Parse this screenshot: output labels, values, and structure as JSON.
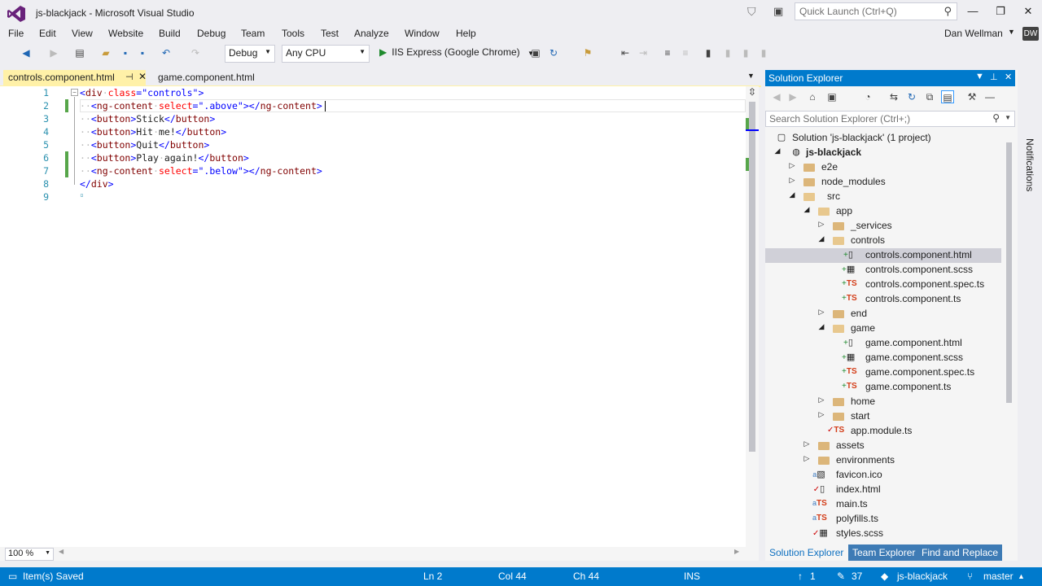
{
  "window": {
    "title": "js-blackjack - Microsoft Visual Studio",
    "quick_launch_placeholder": "Quick Launch (Ctrl+Q)",
    "user_name": "Dan Wellman",
    "user_initials": "DW"
  },
  "menu": [
    "File",
    "Edit",
    "View",
    "Website",
    "Build",
    "Debug",
    "Team",
    "Tools",
    "Test",
    "Analyze",
    "Window",
    "Help"
  ],
  "toolbar": {
    "config": "Debug",
    "platform": "Any CPU",
    "run_label": "IIS Express (Google Chrome)"
  },
  "tabs": {
    "active": "controls.component.html",
    "second": "game.component.html"
  },
  "editor": {
    "line_numbers": [
      "1",
      "2",
      "3",
      "4",
      "5",
      "6",
      "7",
      "8",
      "9"
    ],
    "zoom": "100 %"
  },
  "solution_explorer": {
    "title": "Solution Explorer",
    "search_placeholder": "Search Solution Explorer (Ctrl+;)",
    "nodes": [
      "Solution 'js-blackjack' (1 project)",
      "js-blackjack",
      "e2e",
      "node_modules",
      "src",
      "app",
      "_services",
      "controls",
      "controls.component.html",
      "controls.component.scss",
      "controls.component.spec.ts",
      "controls.component.ts",
      "end",
      "game",
      "game.component.html",
      "game.component.scss",
      "game.component.spec.ts",
      "game.component.ts",
      "home",
      "start",
      "app.module.ts",
      "assets",
      "environments",
      "favicon.ico",
      "index.html",
      "main.ts",
      "polyfills.ts",
      "styles.scss"
    ],
    "bottom_tabs": [
      "Solution Explorer",
      "Team Explorer",
      "Find and Replace"
    ],
    "notifications_label": "Notifications"
  },
  "status": {
    "message": "Item(s) Saved",
    "ln": "Ln 2",
    "col": "Col 44",
    "ch": "Ch 44",
    "mode": "INS",
    "pending": "1",
    "changes": "37",
    "repo": "js-blackjack",
    "branch": "master"
  },
  "colors": {
    "accent": "#007acc",
    "tab_active": "#fff1a8",
    "tag": "#800000",
    "attribute": "#ff0000",
    "value": "#0000ff",
    "line_number": "#2b91af"
  }
}
